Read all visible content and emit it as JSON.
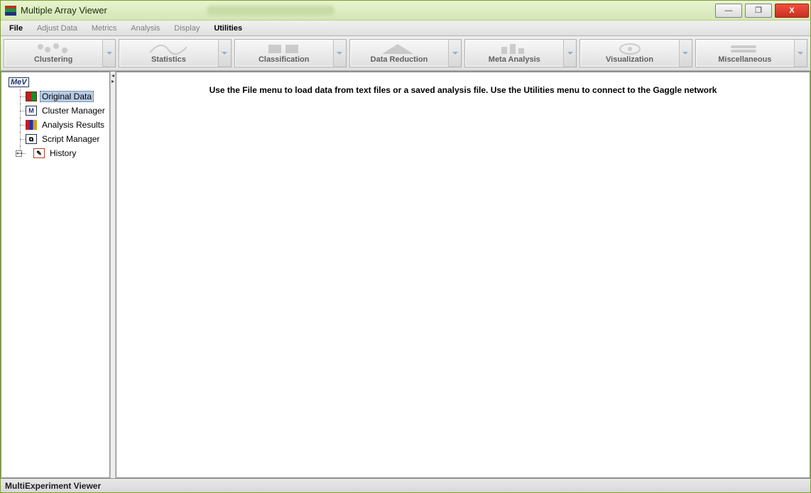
{
  "window": {
    "title": "Multiple Array Viewer"
  },
  "menubar": {
    "items": [
      {
        "label": "File",
        "enabled": true
      },
      {
        "label": "Adjust Data",
        "enabled": false
      },
      {
        "label": "Metrics",
        "enabled": false
      },
      {
        "label": "Analysis",
        "enabled": false
      },
      {
        "label": "Display",
        "enabled": false
      },
      {
        "label": "Utilities",
        "enabled": true
      }
    ]
  },
  "toolbar": {
    "groups": [
      {
        "label": "Clustering"
      },
      {
        "label": "Statistics"
      },
      {
        "label": "Classification"
      },
      {
        "label": "Data Reduction"
      },
      {
        "label": "Meta Analysis"
      },
      {
        "label": "Visualization"
      },
      {
        "label": "Miscellaneous"
      }
    ]
  },
  "tree": {
    "root_label": "MeV",
    "nodes": [
      {
        "label": "Original Data",
        "icon": "origdata",
        "selected": true,
        "expandable": false
      },
      {
        "label": "Cluster Manager",
        "icon": "cluster",
        "selected": false,
        "expandable": false,
        "glyph": "M"
      },
      {
        "label": "Analysis Results",
        "icon": "analysis",
        "selected": false,
        "expandable": false
      },
      {
        "label": "Script Manager",
        "icon": "script",
        "selected": false,
        "expandable": false,
        "glyph": "⧉"
      },
      {
        "label": "History",
        "icon": "history",
        "selected": false,
        "expandable": true,
        "glyph": "✎"
      }
    ]
  },
  "main": {
    "message": "Use the File menu to load data from text files or a saved analysis file. Use the Utilities menu to connect to the Gaggle network"
  },
  "status": {
    "text": "MultiExperiment Viewer"
  },
  "win_controls": {
    "minimize": "—",
    "maximize": "❐",
    "close": "X"
  }
}
